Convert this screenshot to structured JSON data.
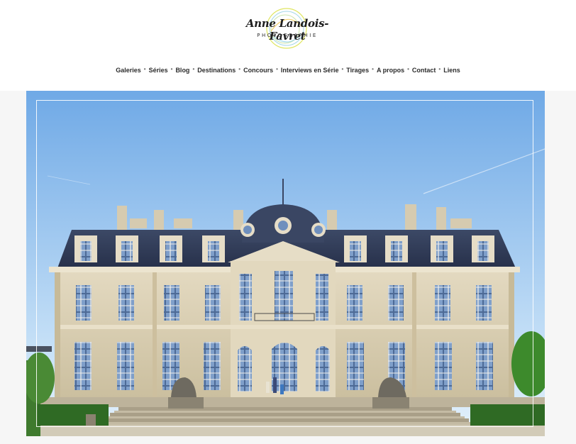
{
  "site": {
    "logo_name": "Anne Landois-Favret",
    "logo_subtitle": "PHOTOGRAPHIE"
  },
  "nav": {
    "items": [
      {
        "label": "Galeries"
      },
      {
        "label": "Séries"
      },
      {
        "label": "Blog"
      },
      {
        "label": "Destinations"
      },
      {
        "label": "Concours"
      },
      {
        "label": "Interviews en Série"
      },
      {
        "label": "Tirages"
      },
      {
        "label": "A propos"
      },
      {
        "label": "Contact"
      },
      {
        "label": "Liens"
      }
    ],
    "separator": "•"
  },
  "colors": {
    "sky_top": "#6fa9e6",
    "sky_bottom": "#d9ecfa",
    "stone": "#d8cdb4",
    "roof": "#2f3a52",
    "hedge": "#3f7a2e"
  }
}
